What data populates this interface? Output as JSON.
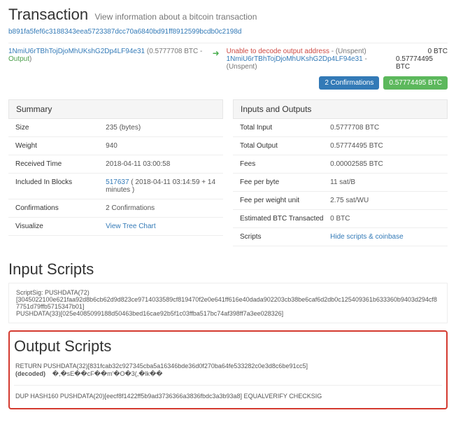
{
  "header": {
    "title": "Transaction",
    "subtitle": "View information about a bitcoin transaction"
  },
  "txid": "b891fa5fef6c3188343eea5723387dcc70a6840bd91ff8912599bcdb0c2198d",
  "input_line": {
    "address": "1NmiU6rTBhTojDjoMhUKshG2Dp4LF94e31",
    "amount_text": "(0.5777708 BTC - ",
    "output_word": "Output",
    "close": ")"
  },
  "outputs": {
    "line1_error": "Unable to decode output address",
    "line1_status": " - (Unspent)",
    "line1_amount": "0 BTC",
    "line2_addr": "1NmiU6rTBhTojDjoMhUKshG2Dp4LF94e31",
    "line2_status": " - (Unspent)",
    "line2_amount": "0.57774495 BTC"
  },
  "badges": {
    "confirmations": "2 Confirmations",
    "btc_total": "0.57774495 BTC"
  },
  "summary": {
    "heading": "Summary",
    "rows": [
      {
        "k": "Size",
        "v": "235 (bytes)"
      },
      {
        "k": "Weight",
        "v": "940"
      },
      {
        "k": "Received Time",
        "v": "2018-04-11 03:00:58"
      },
      {
        "k": "Included In Blocks",
        "v_link": "517637",
        "v_rest": " ( 2018-04-11 03:14:59 + 14 minutes )"
      },
      {
        "k": "Confirmations",
        "v": "2 Confirmations"
      },
      {
        "k": "Visualize",
        "v_link": "View Tree Chart"
      }
    ]
  },
  "io": {
    "heading": "Inputs and Outputs",
    "rows": [
      {
        "k": "Total Input",
        "v": "0.5777708 BTC"
      },
      {
        "k": "Total Output",
        "v": "0.57774495 BTC"
      },
      {
        "k": "Fees",
        "v": "0.00002585 BTC"
      },
      {
        "k": "Fee per byte",
        "v": "11 sat/B"
      },
      {
        "k": "Fee per weight unit",
        "v": "2.75 sat/WU"
      },
      {
        "k": "Estimated BTC Transacted",
        "v": "0 BTC"
      },
      {
        "k": "Scripts",
        "v_link": "Hide scripts & coinbase"
      }
    ]
  },
  "input_scripts": {
    "heading": "Input Scripts",
    "text": "ScriptSig: PUSHDATA(72)\n[3045022100e621faa92d8b6cb62d9d823ce9714033589cf819470f2e0e641ff616e40dada902203cb38be6caf6d2db0c125409361b633360b9403d294cf87751d79ffb5715347b01]\nPUSHDATA(33)[025e4085099188d50463bed16cae92b5f1c03ffba517bc74af398ff7a3ee028326]"
  },
  "output_scripts": {
    "heading": "Output Scripts",
    "line1": "RETURN PUSHDATA(32)[831fcab32c927345cba5a16346bde36d0f270ba64fe533282c0e3d8c6be91cc5]",
    "decoded_label": "(decoded) ",
    "decoded_val": "�,�sE��cF��m'�O�3(,�lk��",
    "line2": "DUP HASH160 PUSHDATA(20)[eecf8f1422ff5b9ad3736366a3836fbdc3a3b93a8] EQUALVERIFY CHECKSIG"
  }
}
